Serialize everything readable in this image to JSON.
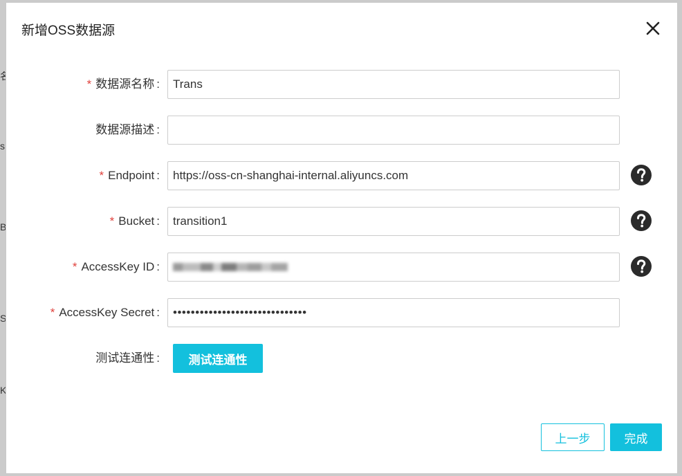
{
  "dialog": {
    "title": "新增OSS数据源"
  },
  "background": {
    "edge_chars": [
      "名",
      "s",
      "B",
      "S",
      "K"
    ]
  },
  "form": {
    "name": {
      "label": "数据源名称",
      "required": true,
      "value": "Trans"
    },
    "description": {
      "label": "数据源描述",
      "required": false,
      "value": ""
    },
    "endpoint": {
      "label": "Endpoint",
      "required": true,
      "value": "https://oss-cn-shanghai-internal.aliyuncs.com"
    },
    "bucket": {
      "label": "Bucket",
      "required": true,
      "value": "transition1"
    },
    "access_key_id": {
      "label": "AccessKey ID",
      "required": true,
      "value": ""
    },
    "access_key_secret": {
      "label": "AccessKey Secret",
      "required": true,
      "value": "••••••••••••••••••••••••••••••"
    },
    "connectivity": {
      "label": "测试连通性",
      "button_label": "测试连通性"
    },
    "colon": ":",
    "required_mark": "*"
  },
  "footer": {
    "prev_label": "上一步",
    "done_label": "完成"
  },
  "colors": {
    "accent": "#13c0dd",
    "required": "#e0413c",
    "help_icon": "#2b2b2b"
  },
  "icons": {
    "close": "close-icon",
    "help": "question-circle-icon"
  }
}
